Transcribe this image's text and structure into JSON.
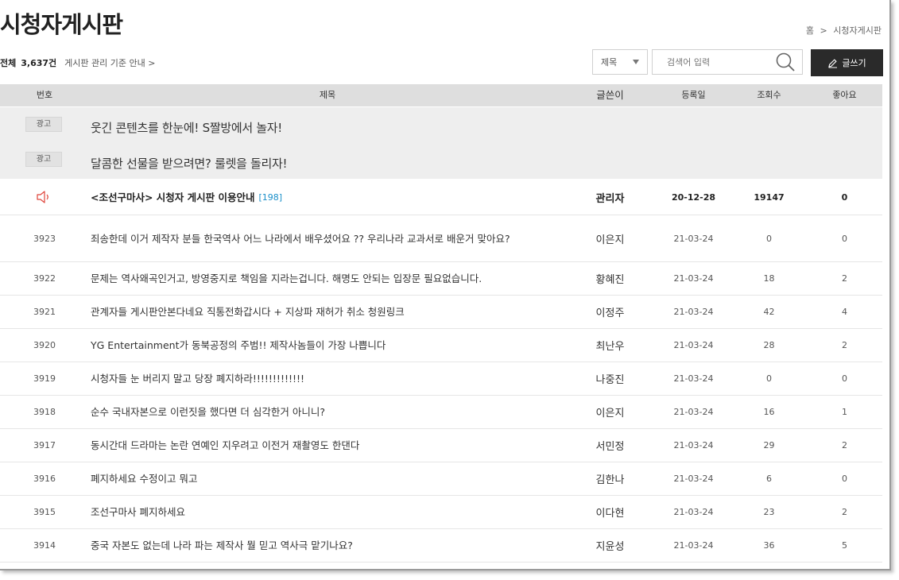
{
  "header": {
    "title": "시청자게시판",
    "breadcrumb": [
      "홈",
      ">",
      "시청자게시판"
    ]
  },
  "summary": {
    "total_label": "전체",
    "total_count": "3,637건",
    "guide_link": "게시판 관리 기준 안내 >"
  },
  "search": {
    "select_value": "제목",
    "placeholder": "검색어 입력",
    "write_button": "글쓰기"
  },
  "table": {
    "headers": [
      "번호",
      "제목",
      "글쓴이",
      "등록일",
      "조회수",
      "좋아요"
    ]
  },
  "ads": [
    {
      "badge": "광고",
      "title": "웃긴 콘텐츠를 한눈에! S짤방에서 놀자!"
    },
    {
      "badge": "광고",
      "title": "달콤한 선물을 받으려면? 룰렛을 돌리자!"
    }
  ],
  "notice": {
    "icon": "speaker-icon",
    "title": "<조선구마사> 시청자 게시판 이용안내",
    "comments": "[198]",
    "author": "관리자",
    "date": "20-12-28",
    "views": "19147",
    "likes": "0"
  },
  "posts": [
    {
      "no": "3923",
      "title": "죄송한데 이거 제작자 분들 한국역사 어느 나라에서 배우셨어요 ?? 우리나라 교과서로 배운거 맞아요?",
      "author": "이은지",
      "date": "21-03-24",
      "views": "0",
      "likes": "0"
    },
    {
      "no": "3922",
      "title": "문제는 역사왜곡인거고, 방영중지로 책임을 지라는겁니다. 해명도 안되는 입장문 필요없습니다.",
      "author": "황혜진",
      "date": "21-03-24",
      "views": "18",
      "likes": "2"
    },
    {
      "no": "3921",
      "title": "관계자들 게시판안본다네요 직통전화갑시다 + 지상파 재허가 취소 청원링크",
      "author": "이정주",
      "date": "21-03-24",
      "views": "42",
      "likes": "4"
    },
    {
      "no": "3920",
      "title": "YG Entertainment가 동북공정의 주범!! 제작사놈들이 가장 나쁩니다",
      "author": "최난우",
      "date": "21-03-24",
      "views": "28",
      "likes": "2"
    },
    {
      "no": "3919",
      "title": "시청자들 눈 버리지 말고 당장 폐지하라!!!!!!!!!!!!!",
      "author": "나중진",
      "date": "21-03-24",
      "views": "0",
      "likes": "0"
    },
    {
      "no": "3918",
      "title": "순수 국내자본으로 이런짓을 했다면 더 심각한거 아니니?",
      "author": "이은지",
      "date": "21-03-24",
      "views": "16",
      "likes": "1"
    },
    {
      "no": "3917",
      "title": "동시간대 드라마는 논란 연예인 지우려고 이전거 재촬영도 한댄다",
      "author": "서민정",
      "date": "21-03-24",
      "views": "29",
      "likes": "2"
    },
    {
      "no": "3916",
      "title": "폐지하세요 수정이고 뭐고",
      "author": "김한나",
      "date": "21-03-24",
      "views": "6",
      "likes": "0"
    },
    {
      "no": "3915",
      "title": "조선구마사 폐지하세요",
      "author": "이다현",
      "date": "21-03-24",
      "views": "23",
      "likes": "2"
    },
    {
      "no": "3914",
      "title": "중국 자본도 없는데 나라 파는 제작사 뭘 믿고 역사극 맡기나요?",
      "author": "지윤성",
      "date": "21-03-24",
      "views": "36",
      "likes": "5"
    }
  ]
}
